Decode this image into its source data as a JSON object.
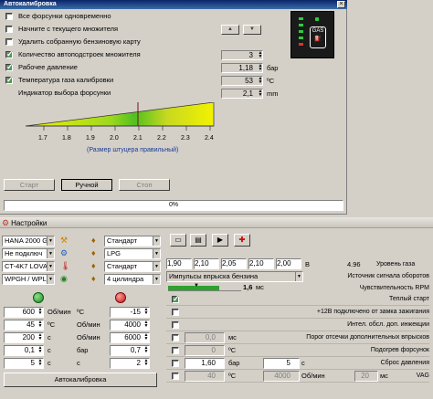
{
  "autocal_window": {
    "title": "Автокалибровка",
    "options": [
      {
        "label": "Все форсунки одновременно",
        "checked": false
      },
      {
        "label": "Начните с текущего множителя",
        "checked": false
      },
      {
        "label": "Удалить собранную бензиновую карту",
        "checked": false
      },
      {
        "label": "Количество автоподстроек множителя",
        "checked": true,
        "value": "3",
        "unit": ""
      },
      {
        "label": "Рабочее давление",
        "checked": true,
        "value": "1,18",
        "unit": "бар"
      },
      {
        "label": "Температура газа калибровки",
        "checked": true,
        "value": "53",
        "unit": "ºC"
      },
      {
        "label": "Индикатор выбора форсунки",
        "checked": false,
        "value": "2,1",
        "unit": "mm"
      }
    ],
    "scale_ticks": [
      "1.7",
      "1.8",
      "1.9",
      "2.0",
      "2.1",
      "2.2",
      "2.3",
      "2.4"
    ],
    "scale_marker": 2.1,
    "scale_caption": "(Размер штуцера правильный)",
    "buttons": {
      "start": "Старт",
      "manual": "Ручной",
      "stop": "Стоп"
    },
    "progress_text": "0%",
    "gas_label": "GAS"
  },
  "settings_window": {
    "title": "Настройки",
    "selects_left": [
      "HANA 2000 G",
      "Не подключ",
      "CT-4K7 LOVA",
      "WPGH / WPL"
    ],
    "selects_mid": [
      "Стандарт",
      "LPG",
      "Стандарт",
      "4 цилиндра"
    ],
    "pressure_values": [
      "1,90",
      "2,10",
      "2,05",
      "2,10",
      "2,00"
    ],
    "pressure_unit": "В",
    "gas_level_value": "4.96",
    "gas_level_label": "Уровень газа",
    "rpm_source": "Импульсы впрыска бензина",
    "rpm_source_label": "Источник сигнала оборотов",
    "rpm_sens_value": "1,6",
    "rpm_sens_unit": "мс",
    "rpm_sens_label": "Чувствительность RPM",
    "left_grid": [
      {
        "a": "600",
        "au": "Об/мин",
        "b": "-15",
        "bu": "ºC"
      },
      {
        "a": "45",
        "au": "ºC",
        "b": "4000",
        "bu": "Об/мин"
      },
      {
        "a": "200",
        "au": "с",
        "b": "6000",
        "bu": "Об/мин"
      },
      {
        "a": "0,1",
        "au": "с",
        "b": "0,7",
        "bu": "бар"
      },
      {
        "a": "5",
        "au": "с",
        "b": "2",
        "bu": "с"
      }
    ],
    "right_rows": [
      {
        "label": "Теплый старт",
        "checked": true
      },
      {
        "label": "+12В подключено от замка зажигания",
        "checked": false
      },
      {
        "label": "Интел. обсл. доп. инжекции",
        "checked": false
      },
      {
        "label": "Порог отсечки дополнительных впрысков",
        "checked": false,
        "value": "0,0",
        "unit": "мс"
      },
      {
        "label": "Подогрев форсунок",
        "checked": false,
        "value": "0",
        "unit": "ºC"
      },
      {
        "label": "Сброс давления",
        "checked": false,
        "value": "1,60",
        "unit": "бар",
        "value2": "5",
        "unit2": "с"
      },
      {
        "label": "VAG",
        "checked": false,
        "value": "40",
        "unit": "ºC",
        "value2": "4000",
        "unit2": "Об/мин",
        "value3": "20",
        "unit3": "мс"
      }
    ],
    "autocal_button": "Автокалибровка"
  }
}
